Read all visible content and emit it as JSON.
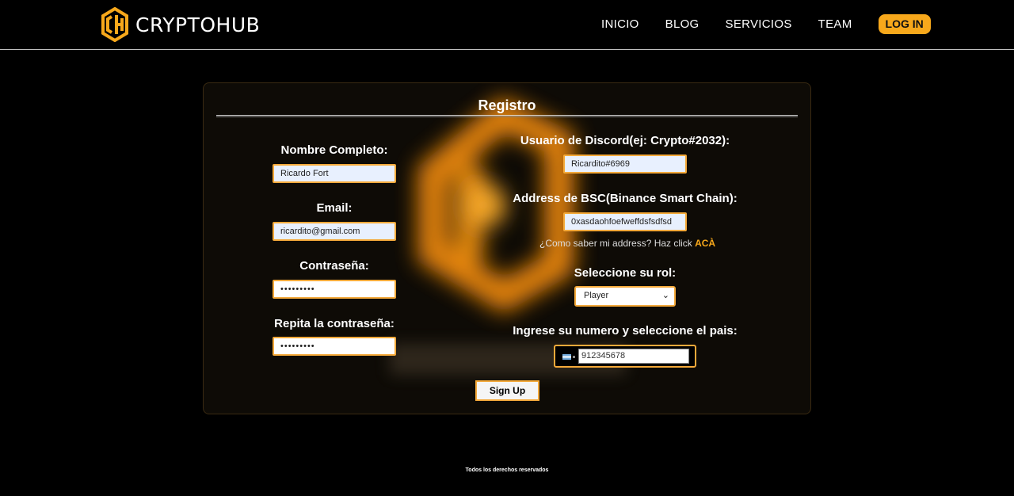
{
  "header": {
    "brand": "CRYPTOHUB",
    "nav": [
      "INICIO",
      "BLOG",
      "SERVICIOS",
      "TEAM"
    ],
    "login_label": "LOG IN"
  },
  "form": {
    "title": "Registro",
    "full_name": {
      "label": "Nombre Completo:",
      "value": "Ricardo Fort"
    },
    "email": {
      "label": "Email:",
      "value": "ricardito@gmail.com"
    },
    "password": {
      "label": "Contraseña:",
      "value": "•••••••••"
    },
    "password_repeat": {
      "label": "Repita la contraseña:",
      "value": "•••••••••"
    },
    "discord": {
      "label": "Usuario de Discord(ej: Crypto#2032):",
      "value": "Ricardito#6969"
    },
    "bsc_address": {
      "label": "Address de BSC(Binance Smart Chain):",
      "value": "0xasdaohfoefweffdsfsdfsd"
    },
    "address_help": {
      "text": "¿Como saber mi address? Haz click",
      "link": "ACÀ"
    },
    "role": {
      "label": "Seleccione su rol:",
      "selected": "Player"
    },
    "phone": {
      "label": "Ingrese su numero y seleccione el pais:",
      "value": "912345678",
      "country_flag": "argentina-flag-icon"
    },
    "signup_label": "Sign Up"
  },
  "footer": {
    "text": "Todos los derechos reservados"
  },
  "colors": {
    "accent": "#f7a81b",
    "background": "#000000",
    "card": "#0e0b06"
  }
}
